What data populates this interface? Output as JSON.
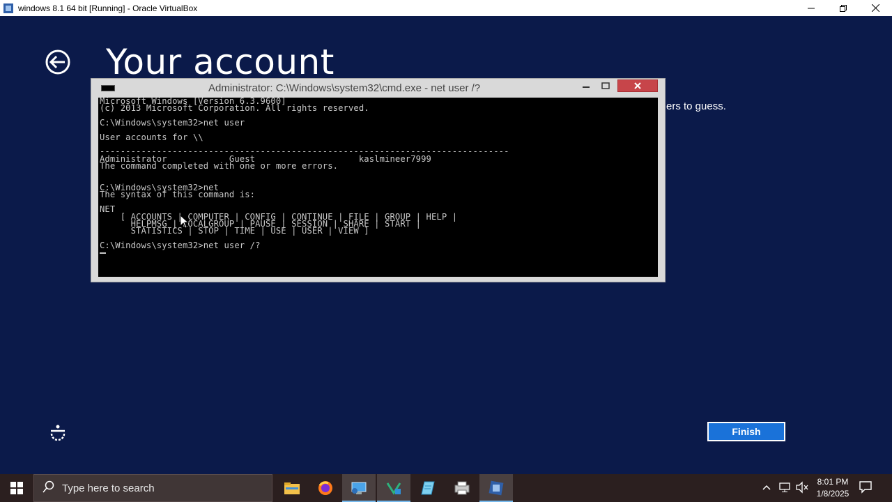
{
  "host_window": {
    "title": "windows 8.1 64 bit [Running] - Oracle VirtualBox"
  },
  "guest": {
    "page_title": "Your account",
    "hint_text_fragment": "ers to guess.",
    "finish_label": "Finish"
  },
  "cmd": {
    "title": "Administrator: C:\\Windows\\system32\\cmd.exe - net  user /?",
    "output_lines": [
      "Microsoft Windows [Version 6.3.9600]",
      "(c) 2013 Microsoft Corporation. All rights reserved.",
      "",
      "C:\\Windows\\system32>net user",
      "",
      "User accounts for \\\\",
      "",
      "-------------------------------------------------------------------------------",
      "Administrator            Guest                    kaslmineer7999",
      "The command completed with one or more errors.",
      "",
      "",
      "C:\\Windows\\system32>net",
      "The syntax of this command is:",
      "",
      "NET",
      "    [ ACCOUNTS | COMPUTER | CONFIG | CONTINUE | FILE | GROUP | HELP |",
      "      HELPMSG | LOCALGROUP | PAUSE | SESSION | SHARE | START |",
      "      STATISTICS | STOP | TIME | USE | USER | VIEW ]",
      "",
      "C:\\Windows\\system32>net user /?"
    ]
  },
  "taskbar": {
    "search_placeholder": "Type here to search",
    "apps": [
      "file-explorer",
      "firefox",
      "remote-desktop",
      "visual-studio",
      "notepad",
      "printer-app",
      "virtualbox"
    ],
    "clock_time": "8:01 PM",
    "clock_date": "1/8/2025"
  },
  "colors": {
    "guest_background": "#0b1a4a",
    "finish_button": "#1a72d9",
    "cmd_close": "#c7454a",
    "taskbar": "#2b1f1f"
  }
}
